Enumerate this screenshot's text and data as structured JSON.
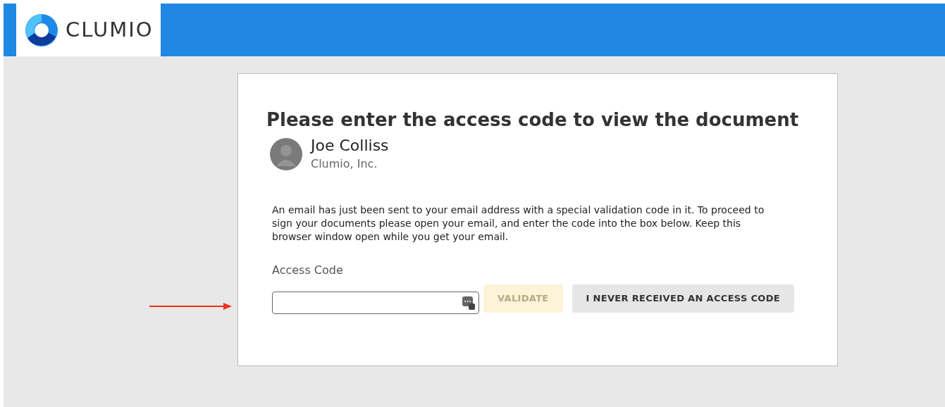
{
  "header": {
    "logo_text": "CLUMIO"
  },
  "card": {
    "title": "Please enter the access code to view the document",
    "sender": {
      "name": "Joe Colliss",
      "company": "Clumio, Inc."
    },
    "message": "An email has just been sent to your email address with a special validation code in it. To proceed to sign your documents please open your email, and enter the code into the box below. Keep this browser window open while you get your email.",
    "field": {
      "label": "Access Code"
    },
    "buttons": [
      {
        "label": "VALIDATE",
        "kind": "primary",
        "disabled": true
      },
      {
        "label": "I NEVER RECEIVED AN ACCESS CODE",
        "kind": "secondary",
        "disabled": false
      }
    ]
  }
}
